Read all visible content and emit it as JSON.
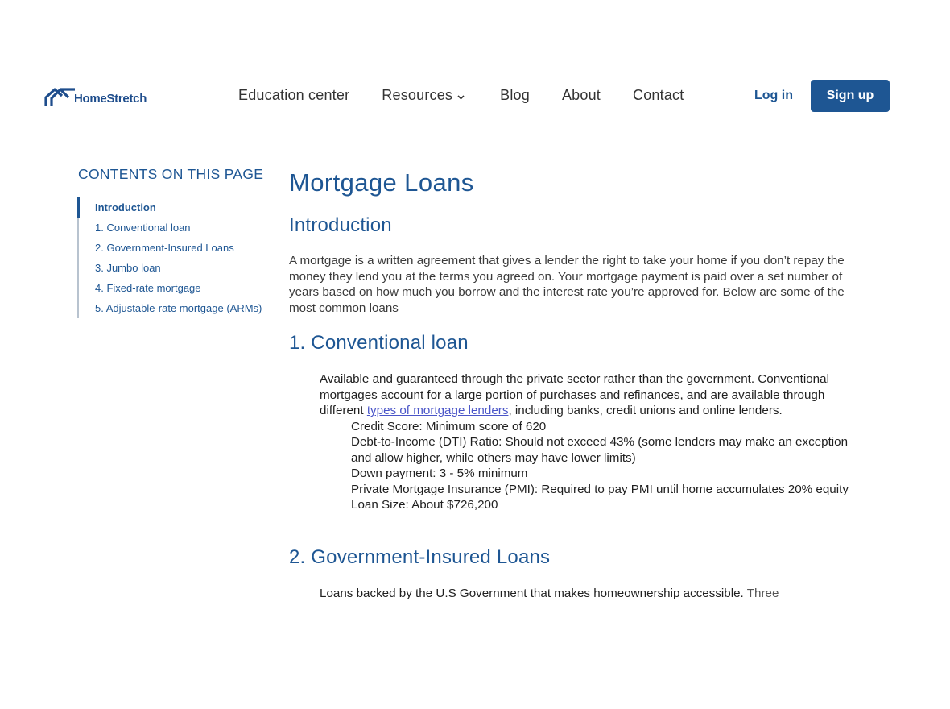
{
  "header": {
    "logo_text": "HomeStretch",
    "nav": [
      {
        "label": "Education center"
      },
      {
        "label": "Resources"
      },
      {
        "label": "Blog"
      },
      {
        "label": "About"
      },
      {
        "label": "Contact"
      }
    ],
    "login_label": "Log in",
    "signup_label": "Sign up"
  },
  "toc": {
    "title": "CONTENTS ON THIS PAGE",
    "items": [
      {
        "label": "Introduction"
      },
      {
        "label": "1. Conventional loan"
      },
      {
        "label": "2. Government-Insured Loans"
      },
      {
        "label": "3. Jumbo loan"
      },
      {
        "label": "4. Fixed-rate mortgage"
      },
      {
        "label": "5. Adjustable-rate mortgage (ARMs)"
      }
    ]
  },
  "main": {
    "title": "Mortgage Loans",
    "intro": {
      "heading": "Introduction",
      "text": "A mortgage is a written agreement that gives a lender the right to take your home if you don’t repay the money they lend you at the terms you agreed on. Your mortgage payment is paid over a set number of years based on how much you borrow and the interest rate you’re approved for. Below are some of the most common loans"
    },
    "conventional": {
      "heading": "1. Conventional loan",
      "text_before_link": "Available and guaranteed through the private sector rather than the government. Conventional mortgages account for a large portion of purchases and refinances, and are available through different ",
      "link_text": "types of mortgage lenders",
      "text_after_link": ", including banks, credit unions and online lenders.",
      "items": [
        "Credit Score: Minimum score of 620",
        "Debt-to-Income (DTI) Ratio: Should not exceed 43% (some lenders may make an exception and allow higher, while others may have lower limits)",
        "Down payment: 3 - 5% minimum",
        "Private Mortgage Insurance (PMI): Required to pay PMI until home accumulates 20% equity",
        "Loan Size: About $726,200"
      ]
    },
    "government": {
      "heading": "2. Government-Insured Loans",
      "text": "Loans backed by the U.S Government that makes homeownership accessible.",
      "text_faded": "Three"
    }
  }
}
